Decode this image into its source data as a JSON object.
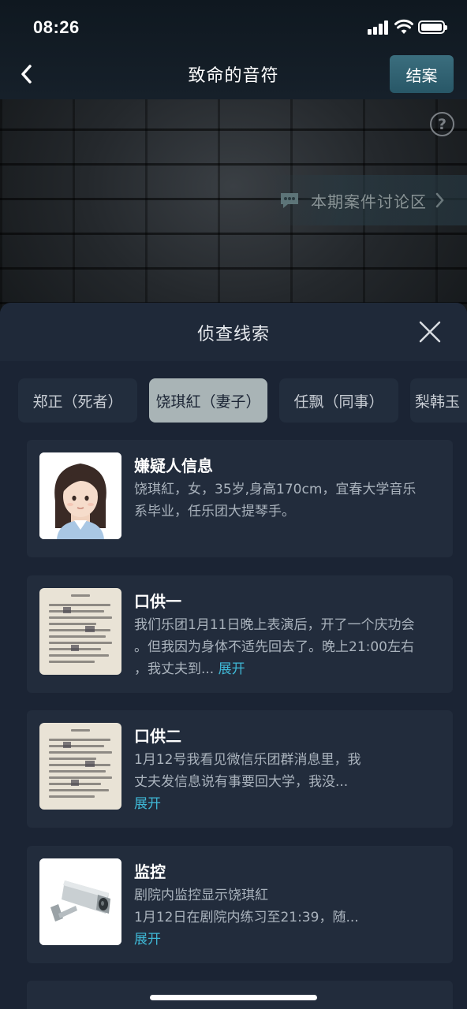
{
  "status_bar": {
    "time": "08:26"
  },
  "nav": {
    "title": "致命的音符",
    "close_case_label": "结案"
  },
  "discussion": {
    "label": "本期案件讨论区"
  },
  "sheet": {
    "title": "侦查线索",
    "tabs": [
      {
        "label": "郑正（死者）",
        "active": false
      },
      {
        "label": "饶琪紅（妻子）",
        "active": true
      },
      {
        "label": "任飘（同事）",
        "active": false
      },
      {
        "label": "梨韩玉",
        "active": false
      }
    ],
    "clues": [
      {
        "title": "嫌疑人信息",
        "lines": [
          "饶琪紅，女，35岁,身高170cm，宜春大学音乐",
          "系毕业，任乐团大提琴手。"
        ],
        "thumb": "avatar-woman"
      },
      {
        "title": "口供一",
        "lines": [
          "我们乐团1月11日晚上表演后，开了一个庆功会",
          "。但我因为身体不适先回去了。晚上21:00左右",
          "，我丈夫到..."
        ],
        "expand": "展开",
        "thumb": "document"
      },
      {
        "title": "口供二",
        "lines": [
          "1月12号我看见微信乐团群消息里，我",
          "丈夫发信息说有事要回大学，我没..."
        ],
        "expand": "展开",
        "thumb": "document"
      },
      {
        "title": "监控",
        "lines": [
          "剧院内监控显示饶琪紅",
          "1月12日在剧院内练习至21:39，随..."
        ],
        "expand": "展开",
        "thumb": "cctv-camera"
      }
    ]
  },
  "colors": {
    "accent": "#3fb8d6",
    "sheet_bg": "#1b2434",
    "card_bg": "#222c3c",
    "button": "#2f6373"
  }
}
